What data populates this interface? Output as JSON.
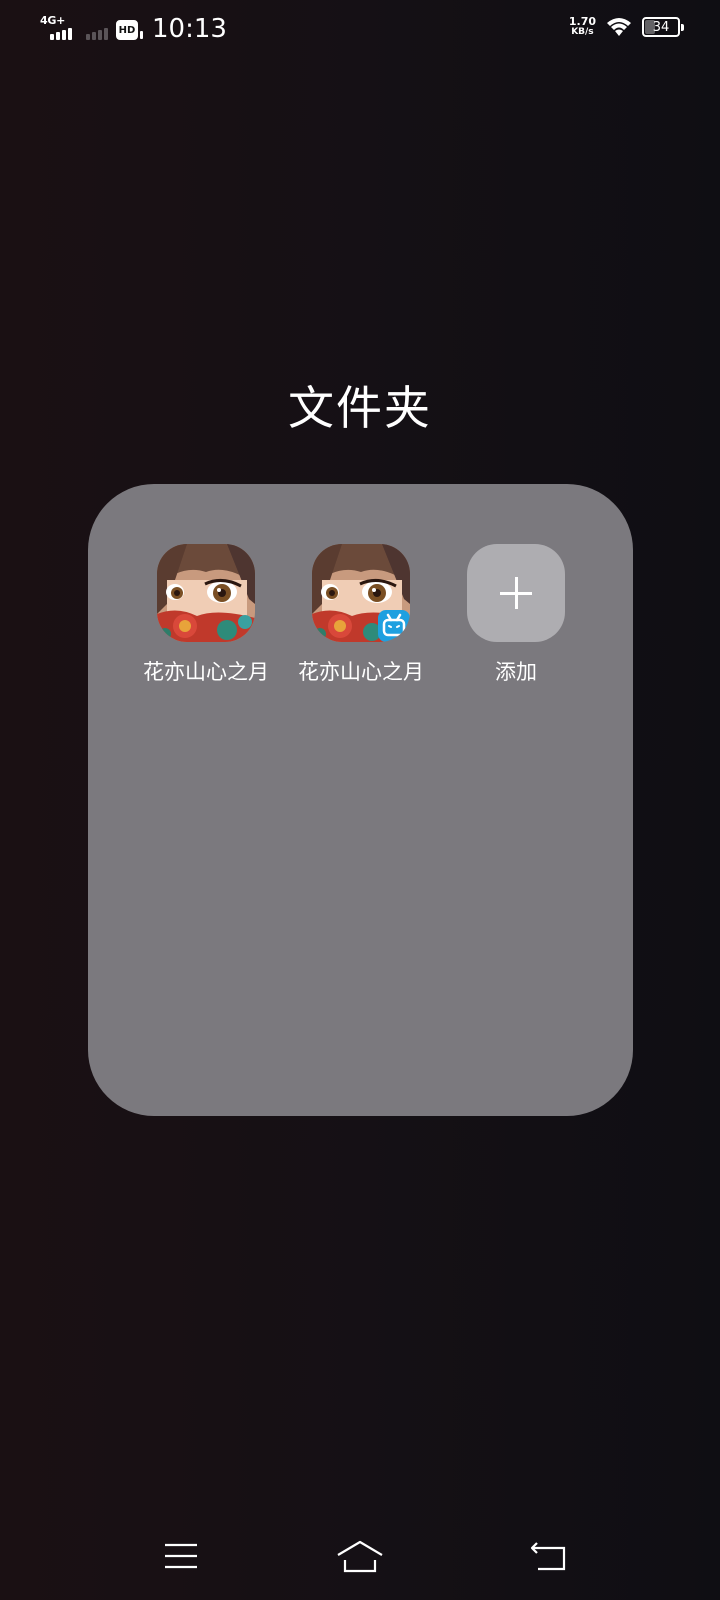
{
  "status_bar": {
    "network_type": "4G+",
    "hd_label": "HD",
    "time": "10:13",
    "speed_value": "1.70",
    "speed_unit": "KB/s",
    "battery_level": "34"
  },
  "folder": {
    "title": "文件夹",
    "apps": [
      {
        "label": "花亦山心之月",
        "icon": "anime-girl-app-icon"
      },
      {
        "label": "花亦山心之月",
        "icon": "anime-girl-app-icon-with-badge"
      }
    ],
    "add_label": "添加"
  },
  "nav_bar": {
    "items": [
      "menu-icon",
      "home-icon",
      "back-icon"
    ]
  },
  "colors": {
    "panel_bg": "#7b797e",
    "add_bg": "#aeadb1",
    "badge": "#1ea0e0"
  }
}
